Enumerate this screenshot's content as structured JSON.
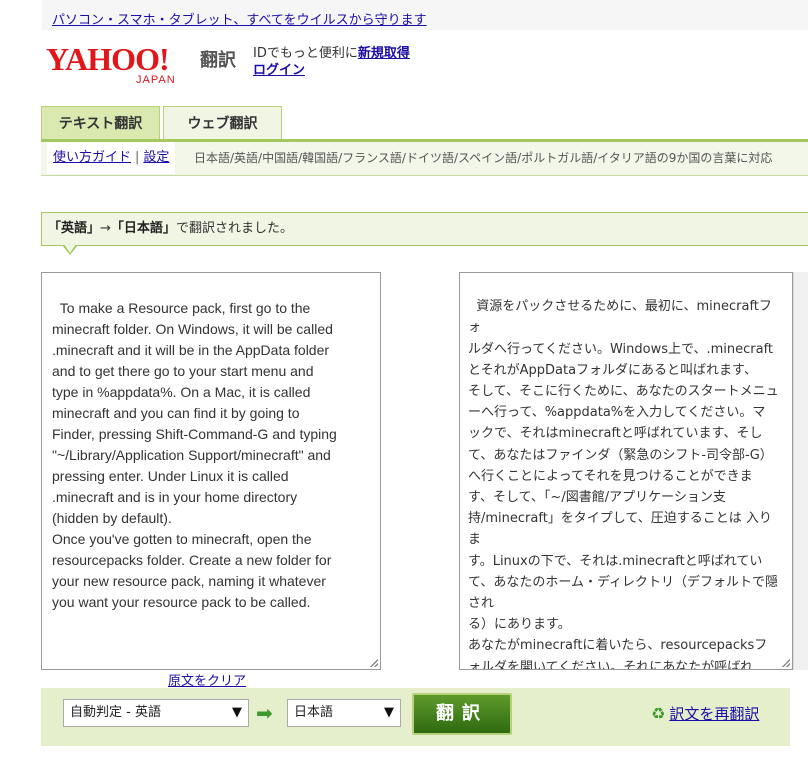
{
  "top_banner": {
    "link_text": "パソコン・スマホ・タブレット、すべてをウイルスから守ります"
  },
  "header": {
    "logo_text": "YAHOO!",
    "logo_sub": "JAPAN",
    "service_name": "翻訳",
    "account_prefix": "IDでもっと便利に",
    "register_link": "新規取得",
    "login_link": "ログイン"
  },
  "tabs": [
    {
      "label": "テキスト翻訳",
      "active": true
    },
    {
      "label": "ウェブ翻訳",
      "active": false
    }
  ],
  "subnav": {
    "help_link": "使い方ガイド",
    "settings_link": "設定",
    "separator": "|",
    "languages_text": "日本語/英語/中国語/韓国語/フランス語/ドイツ語/スペイン語/ポルトガル語/イタリア語の9か国の言葉に対応"
  },
  "notice": {
    "src_lang": "「英語」",
    "arrow": "→",
    "dst_lang": "「日本語」",
    "suffix": "で翻訳されました。"
  },
  "source_text": "To make a Resource pack, first go to the\nminecraft folder. On Windows, it will be called\n.minecraft and it will be in the AppData folder\nand to get there go to your start menu and\ntype in %appdata%. On a Mac, it is called\nminecraft and you can find it by going to\nFinder, pressing Shift-Command-G and typing\n\"~/Library/Application Support/minecraft\" and\npressing enter. Under Linux it is called\n.minecraft and is in your home directory\n(hidden by default).\nOnce you've gotten to minecraft, open the\nresourcepacks folder. Create a new folder for\nyour new resource pack, naming it whatever\nyou want your resource pack to be called.",
  "translated_text": "資源をパックさせるために、最初に、minecraftフォ\nルダへ行ってください。Windows上で、.minecraft\nとそれがAppDataフォルダにあると叫ばれます、\nそして、そこに行くために、あなたのスタートメニュ\nーへ行って、%appdata%を入力してください。マ\nックで、それはminecraftと呼ばれています、そし\nて、あなたはファインダ（緊急のシフト-司令部-G）\nへ行くことによってそれを見つけることができま\nす、そして、「~/図書館/アプリケーション支\n持/minecraft」をタイプして、圧迫することは 入りま\nす。Linuxの下で、それは.minecraftと呼ばれてい\nて、あなたのホーム・ディレクトリ（デフォルトで隠され\nる）にあります。\nあなたがminecraftに着いたら、resourcepacksフ\nォルダを開いてください。それにあなたが呼ばれ\nる資源パックにしてもらいたいものは 何という名前\nをつけてでも、あなたの 新しい 資源パックのために\n新しいフォルダを作製してください。",
  "clear_link": "原文をクリア",
  "controls": {
    "source_select": "自動判定 - 英語",
    "target_select": "日本語",
    "arrow": "➡",
    "caret": "▼",
    "translate_button": "翻訳",
    "retranslate_link": "訳文を再翻訳",
    "retranslate_icon": "♻"
  },
  "colors": {
    "brand_red": "#e0161b",
    "accent_green": "#a5c85e",
    "button_green": "#3d7a1a",
    "link_blue": "#1a0dab"
  }
}
